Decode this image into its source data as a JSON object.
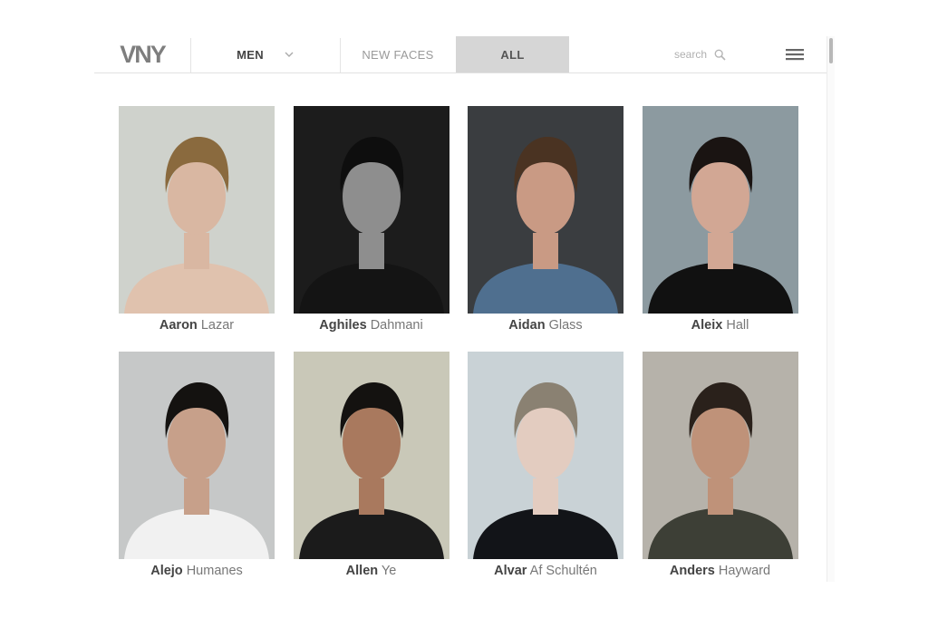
{
  "header": {
    "logo": "VNY",
    "tabs": {
      "men": "MEN",
      "new_faces": "NEW FACES",
      "all": "ALL"
    },
    "search_placeholder": "search"
  },
  "models": [
    {
      "first": "Aaron",
      "last": "Lazar",
      "bg": "#cfd2cc",
      "skin": "#d9b7a2",
      "hair": "#8a6a3e",
      "shirt": "#e0c2ae"
    },
    {
      "first": "Aghiles",
      "last": "Dahmani",
      "bg": "#1c1c1c",
      "skin": "#8e8e8e",
      "hair": "#0e0e0e",
      "shirt": "#141414"
    },
    {
      "first": "Aidan",
      "last": "Glass",
      "bg": "#3a3d40",
      "skin": "#c99a84",
      "hair": "#4a3322",
      "shirt": "#4f6f8f"
    },
    {
      "first": "Aleix",
      "last": "Hall",
      "bg": "#8c9aa0",
      "skin": "#d2a794",
      "hair": "#1a1412",
      "shirt": "#111111"
    },
    {
      "first": "Alejo",
      "last": "Humanes",
      "bg": "#c6c8c8",
      "skin": "#c7a08a",
      "hair": "#141210",
      "shirt": "#f1f1f1"
    },
    {
      "first": "Allen",
      "last": "Ye",
      "bg": "#c9c8b8",
      "skin": "#a9795e",
      "hair": "#141210",
      "shirt": "#1b1b1b"
    },
    {
      "first": "Alvar",
      "last": "Af Schultén",
      "bg": "#c9d2d6",
      "skin": "#e3ccc0",
      "hair": "#8a8172",
      "shirt": "#121418"
    },
    {
      "first": "Anders",
      "last": "Hayward",
      "bg": "#b6b2aa",
      "skin": "#bf9279",
      "hair": "#2a211b",
      "shirt": "#3d3f36"
    }
  ]
}
